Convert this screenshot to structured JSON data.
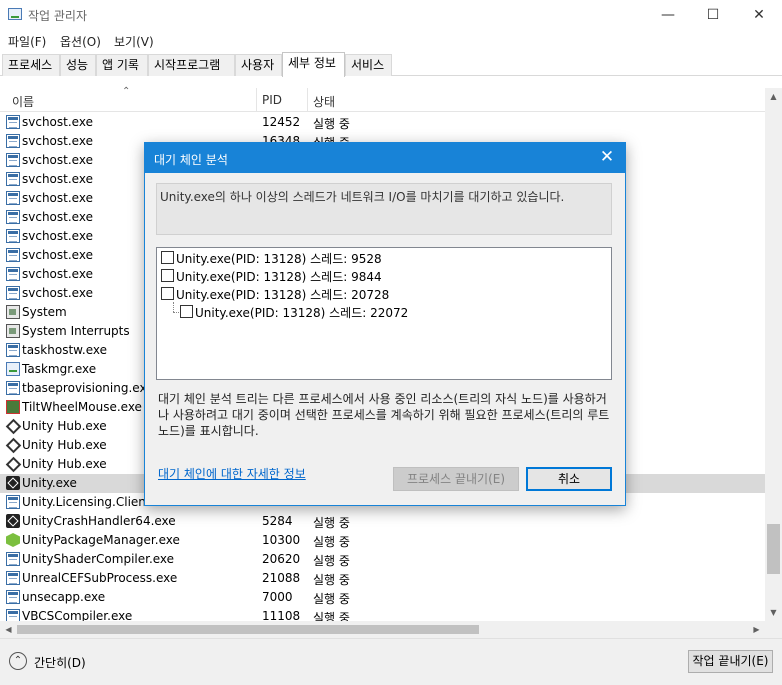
{
  "window": {
    "title": "작업 관리자",
    "min_icon": "minimize-icon",
    "max_icon": "maximize-icon",
    "close_icon": "close-icon"
  },
  "menu": [
    "파일(F)",
    "옵션(O)",
    "보기(V)"
  ],
  "tabs": [
    "프로세스",
    "성능",
    "앱 기록",
    "시작프로그램",
    "사용자",
    "세부 정보",
    "서비스"
  ],
  "active_tab": "세부 정보",
  "columns": {
    "name": "이름",
    "pid": "PID",
    "status": "상태"
  },
  "rows": [
    {
      "icon": "svc",
      "name": "svchost.exe",
      "pid": "12452",
      "status": "실행 중"
    },
    {
      "icon": "svc",
      "name": "svchost.exe",
      "pid": "16348",
      "status": "실행 중"
    },
    {
      "icon": "svc",
      "name": "svchost.exe",
      "pid": "",
      "status": ""
    },
    {
      "icon": "svc",
      "name": "svchost.exe",
      "pid": "",
      "status": ""
    },
    {
      "icon": "svc",
      "name": "svchost.exe",
      "pid": "",
      "status": ""
    },
    {
      "icon": "svc",
      "name": "svchost.exe",
      "pid": "",
      "status": ""
    },
    {
      "icon": "svc",
      "name": "svchost.exe",
      "pid": "",
      "status": ""
    },
    {
      "icon": "svc",
      "name": "svchost.exe",
      "pid": "",
      "status": ""
    },
    {
      "icon": "svc",
      "name": "svchost.exe",
      "pid": "",
      "status": ""
    },
    {
      "icon": "svc",
      "name": "svchost.exe",
      "pid": "",
      "status": ""
    },
    {
      "icon": "sys",
      "name": "System",
      "pid": "",
      "status": ""
    },
    {
      "icon": "sys",
      "name": "System Interrupts",
      "pid": "",
      "status": ""
    },
    {
      "icon": "svc",
      "name": "taskhostw.exe",
      "pid": "",
      "status": ""
    },
    {
      "icon": "task",
      "name": "Taskmgr.exe",
      "pid": "",
      "status": ""
    },
    {
      "icon": "svc",
      "name": "tbaseprovisioning.exe",
      "pid": "",
      "status": ""
    },
    {
      "icon": "tilt",
      "name": "TiltWheelMouse.exe",
      "pid": "",
      "status": ""
    },
    {
      "icon": "hub",
      "name": "Unity Hub.exe",
      "pid": "",
      "status": ""
    },
    {
      "icon": "hub",
      "name": "Unity Hub.exe",
      "pid": "",
      "status": ""
    },
    {
      "icon": "hub",
      "name": "Unity Hub.exe",
      "pid": "",
      "status": ""
    },
    {
      "icon": "unity",
      "name": "Unity.exe",
      "pid": "",
      "status": "",
      "selected": true
    },
    {
      "icon": "svc",
      "name": "Unity.Licensing.Client.exe",
      "pid": "",
      "status": ""
    },
    {
      "icon": "unity",
      "name": "UnityCrashHandler64.exe",
      "pid": "5284",
      "status": "실행 중"
    },
    {
      "icon": "pkg",
      "name": "UnityPackageManager.exe",
      "pid": "10300",
      "status": "실행 중"
    },
    {
      "icon": "svc",
      "name": "UnityShaderCompiler.exe",
      "pid": "20620",
      "status": "실행 중"
    },
    {
      "icon": "svc",
      "name": "UnrealCEFSubProcess.exe",
      "pid": "21088",
      "status": "실행 중"
    },
    {
      "icon": "svc",
      "name": "unsecapp.exe",
      "pid": "7000",
      "status": "실행 중"
    },
    {
      "icon": "svc",
      "name": "VBCSCompiler.exe",
      "pid": "11108",
      "status": "실행 중"
    }
  ],
  "footer": {
    "less_details": "간단히(D)",
    "end_task": "작업 끝내기(E)"
  },
  "dialog": {
    "title": "대기 체인 분석",
    "message": "Unity.exe의 하나 이상의 스레드가 네트워크 I/O를 마치기를 대기하고 있습니다.",
    "tree": [
      "Unity.exe(PID: 13128) 스레드: 9528",
      "Unity.exe(PID: 13128) 스레드: 9844",
      "Unity.exe(PID: 13128) 스레드: 20728",
      "Unity.exe(PID: 13128) 스레드: 22072"
    ],
    "description": "대기 체인 분석 트리는 다른 프로세스에서 사용 중인 리소스(트리의 자식 노드)를 사용하거나 사용하려고 대기 중이며 선택한 프로세스를 계속하기 위해 필요한 프로세스(트리의 루트 노드)를 표시합니다.",
    "link": "대기 체인에 대한 자세한 정보",
    "end_process": "프로세스 끝내기(E)",
    "cancel": "취소"
  }
}
